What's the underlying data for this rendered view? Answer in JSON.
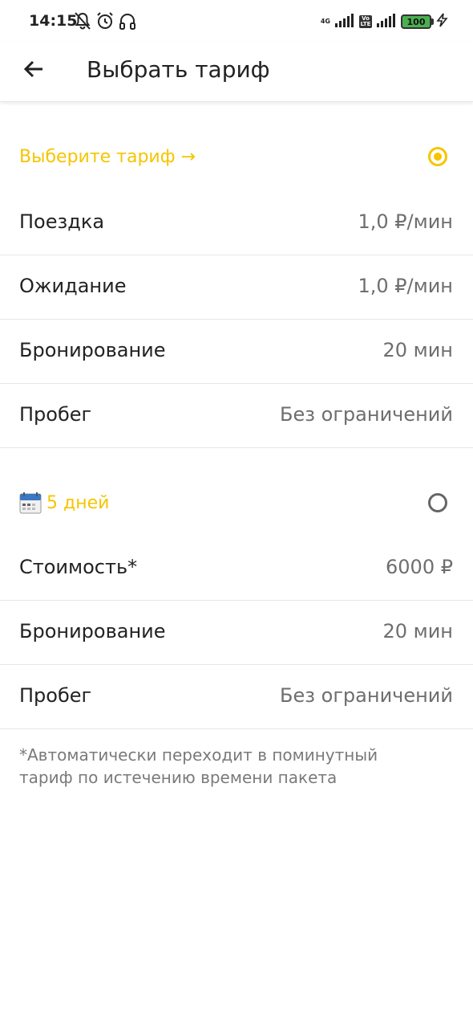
{
  "status_bar": {
    "time": "14:15",
    "network": "4G",
    "volte": "Vo LTE",
    "battery": "100"
  },
  "app_bar": {
    "title": "Выбрать тариф"
  },
  "tariffs": [
    {
      "title": "Выберите тариф →",
      "selected": true,
      "rows": [
        {
          "label": "Поездка",
          "value": "1,0 ₽/мин"
        },
        {
          "label": "Ожидание",
          "value": "1,0 ₽/мин"
        },
        {
          "label": "Бронирование",
          "value": "20 мин"
        },
        {
          "label": "Пробег",
          "value": "Без ограничений"
        }
      ]
    },
    {
      "icon": "calendar-icon",
      "title": "5 дней",
      "selected": false,
      "rows": [
        {
          "label": "Стоимость*",
          "value": "6000 ₽"
        },
        {
          "label": "Бронирование",
          "value": "20 мин"
        },
        {
          "label": "Пробег",
          "value": "Без ограничений"
        }
      ]
    }
  ],
  "footnote": "*Автоматически переходит в поминутный тариф по истечению времени пакета",
  "colors": {
    "accent": "#f5c500",
    "text": "#222222",
    "secondary_text": "#6e6e6e",
    "divider": "#e6e6e6"
  }
}
